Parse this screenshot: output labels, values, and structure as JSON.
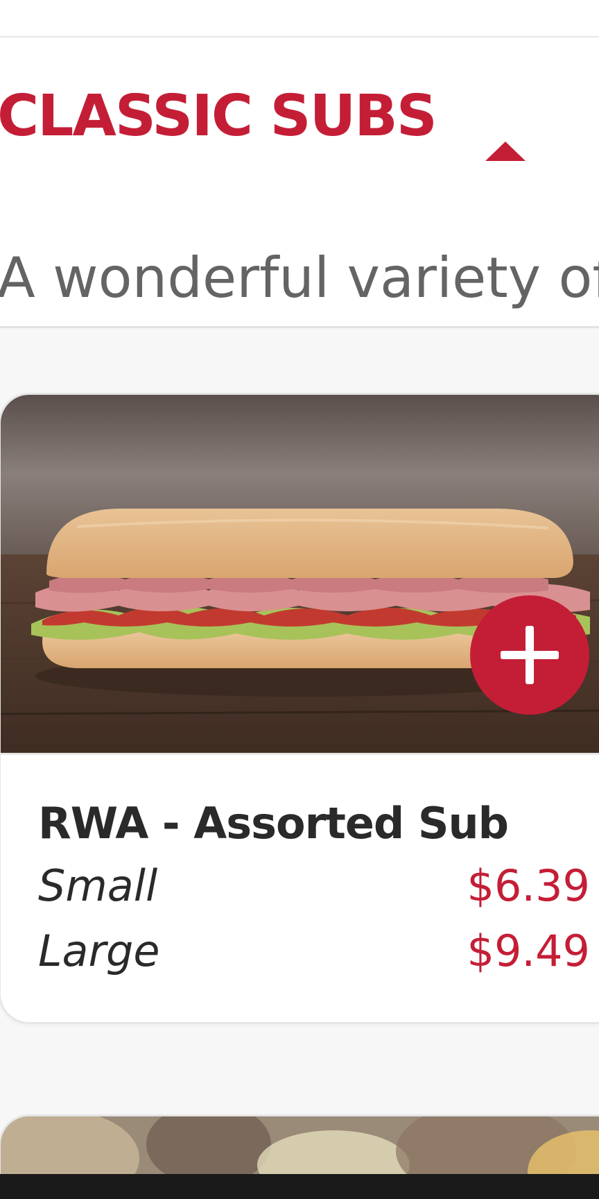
{
  "section": {
    "title": "CLASSIC SUBS",
    "description": "A wonderful variety of",
    "toggle_icon": "caret-up-icon",
    "expanded": true
  },
  "product": {
    "name": "RWA - Assorted Sub",
    "image_icon": "sub-sandwich-photo",
    "add_icon": "plus-icon",
    "sizes": [
      {
        "label": "Small",
        "price": "$6.39"
      },
      {
        "label": "Large",
        "price": "$9.49"
      }
    ]
  },
  "colors": {
    "accent": "#c41e36",
    "title_text": "#2a2a2a",
    "desc_text": "#646464",
    "border": "#e6e6e6"
  }
}
